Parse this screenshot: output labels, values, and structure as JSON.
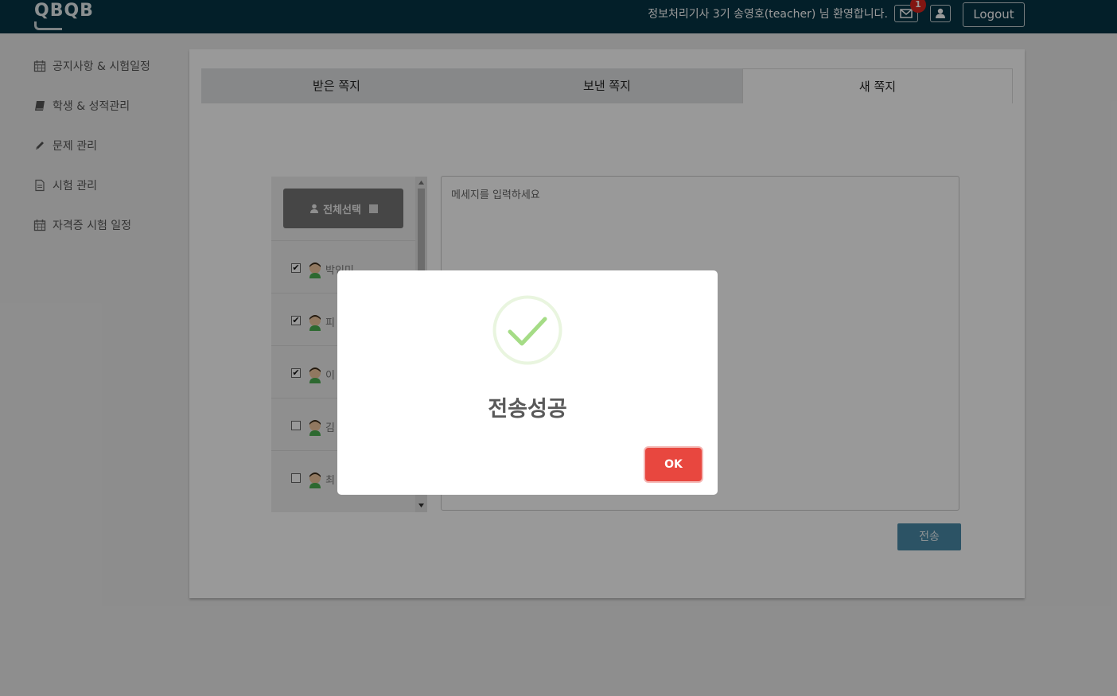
{
  "header": {
    "logo_text": "QBQB",
    "welcome_text": "정보처리기사 3기 송영호(teacher) 님 환영합니다.",
    "mail_icon": "envelope-icon",
    "unread_count": "1",
    "user_icon": "user-icon",
    "logout_label": "Logout",
    "bg_color": "#053445"
  },
  "sidebar": {
    "items": [
      {
        "label": "공지사항 & 시험일정",
        "icon": "calendar-icon"
      },
      {
        "label": "학생 & 성적관리",
        "icon": "book-icon"
      },
      {
        "label": "문제 관리",
        "icon": "pencil-icon"
      },
      {
        "label": "시험 관리",
        "icon": "document-icon"
      },
      {
        "label": "자격증 시험 일정",
        "icon": "calendar-icon"
      }
    ]
  },
  "tabs": [
    {
      "label": "받은 쪽지",
      "active": false
    },
    {
      "label": "보낸 쪽지",
      "active": false
    },
    {
      "label": "새 쪽지",
      "active": true
    }
  ],
  "recipients": {
    "select_all_label": "전체선택",
    "rows": [
      {
        "name": "박인미",
        "checked": true
      },
      {
        "name": "피",
        "checked": true
      },
      {
        "name": "이",
        "checked": true
      },
      {
        "name": "김",
        "checked": false
      },
      {
        "name": "최",
        "checked": false
      }
    ]
  },
  "message": {
    "placeholder": "메세지를 입력하세요",
    "send_label": "전송"
  },
  "modal": {
    "icon": "success-check-icon",
    "title": "전송성공",
    "ok_label": "OK",
    "ok_color": "#e8473f"
  }
}
